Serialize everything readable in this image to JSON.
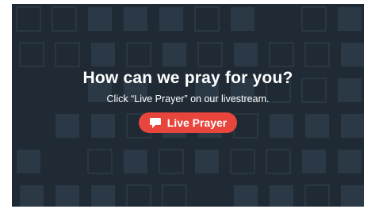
{
  "slide": {
    "headline": "How can we pray for you?",
    "subline": "Click “Live Prayer” on our livestream.",
    "button": {
      "label": "Live Prayer",
      "icon": "chat-bubble-icon"
    }
  },
  "colors": {
    "background": "#1f2a35",
    "accent": "#e8453c",
    "text": "#ffffff"
  }
}
